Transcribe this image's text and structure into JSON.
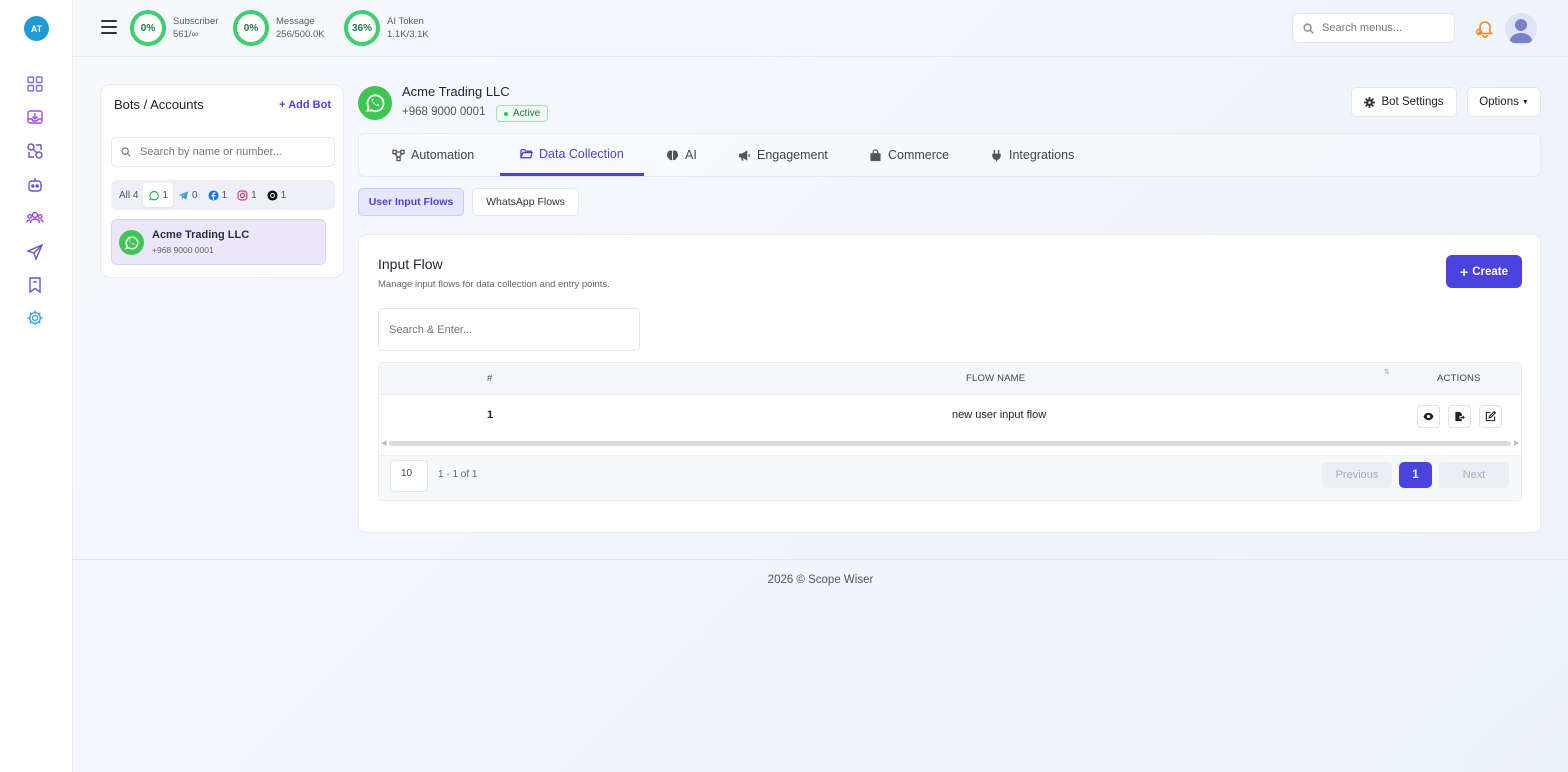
{
  "app": {
    "logo_initials": "AT",
    "footer": "2026 © Scope Wiser"
  },
  "sidebar": {
    "items": [
      {
        "icon": "dashboard-grid-icon"
      },
      {
        "icon": "inbox-download-icon"
      },
      {
        "icon": "link-network-icon"
      },
      {
        "icon": "bot-icon"
      },
      {
        "icon": "users-group-icon"
      },
      {
        "icon": "send-paper-plane-icon"
      },
      {
        "icon": "bookmark-icon"
      },
      {
        "icon": "settings-gear-icon"
      }
    ]
  },
  "topbar": {
    "stats": [
      {
        "percent": "0%",
        "label": "Subscriber",
        "value": "561/∞"
      },
      {
        "percent": "0%",
        "label": "Message",
        "value": "256/500.0K"
      },
      {
        "percent": "36%",
        "label": "AI Token",
        "value": "1.1K/3.1K"
      }
    ],
    "search_placeholder": "Search menus..."
  },
  "bots_panel": {
    "title": "Bots / Accounts",
    "add_label": "Add Bot",
    "search_placeholder": "Search by name or number...",
    "filters": [
      {
        "label": "All",
        "count": "4"
      },
      {
        "icon": "whatsapp-icon",
        "count": "1"
      },
      {
        "icon": "telegram-icon",
        "count": "0"
      },
      {
        "icon": "facebook-icon",
        "count": "1"
      },
      {
        "icon": "instagram-icon",
        "count": "1"
      },
      {
        "icon": "threads-icon",
        "count": "1"
      }
    ],
    "bots": [
      {
        "name": "Acme Trading LLC",
        "number": "+968 9000 0001"
      }
    ]
  },
  "account": {
    "name": "Acme Trading LLC",
    "number": "+968 9000 0001",
    "status": "Active",
    "settings_label": "Bot Settings",
    "options_label": "Options"
  },
  "tabs": [
    {
      "label": "Automation",
      "icon": "automation-icon"
    },
    {
      "label": "Data Collection",
      "icon": "folder-open-icon",
      "active": true
    },
    {
      "label": "AI",
      "icon": "brain-icon"
    },
    {
      "label": "Engagement",
      "icon": "megaphone-icon"
    },
    {
      "label": "Commerce",
      "icon": "shopping-bag-icon"
    },
    {
      "label": "Integrations",
      "icon": "plug-icon"
    }
  ],
  "subtabs": [
    {
      "label": "User Input Flows",
      "active": true
    },
    {
      "label": "WhatsApp Flows"
    }
  ],
  "input_flow": {
    "title": "Input Flow",
    "subtitle": "Manage input flows for data collection and entry points.",
    "create_label": "Create",
    "search_placeholder": "Search & Enter...",
    "columns": [
      "#",
      "FLOW NAME",
      "ACTIONS"
    ],
    "rows": [
      {
        "index": "1",
        "name": "new user input flow"
      }
    ],
    "page_size": "10",
    "range": "1 - 1 of 1",
    "prev_label": "Previous",
    "current_page": "1",
    "next_label": "Next"
  },
  "colors": {
    "accent": "#4b43e0",
    "whatsapp": "#3ec653",
    "ring": "#3ecf6e"
  }
}
